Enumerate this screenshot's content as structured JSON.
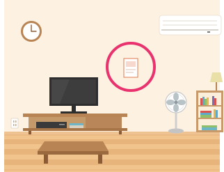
{
  "scene": {
    "colors": {
      "wall": "#fdf1e2",
      "floor_light": "#f2c48d",
      "floor_dark": "#e2ad73",
      "floor_line": "#d89c62",
      "baseboard": "#eec391",
      "highlight": "#e8336f",
      "wood": "#b98453",
      "wood_dark": "#8b5b35",
      "tv": "#2e2e2e",
      "ac": "#ffffff"
    },
    "icons": [
      "wall-clock-icon",
      "air-conditioner-icon",
      "wall-poster-icon",
      "television-icon",
      "tv-stand-icon",
      "electric-fan-icon",
      "floor-lamp-icon",
      "bookshelf-icon",
      "low-table-icon",
      "wall-outlet-icon"
    ]
  }
}
